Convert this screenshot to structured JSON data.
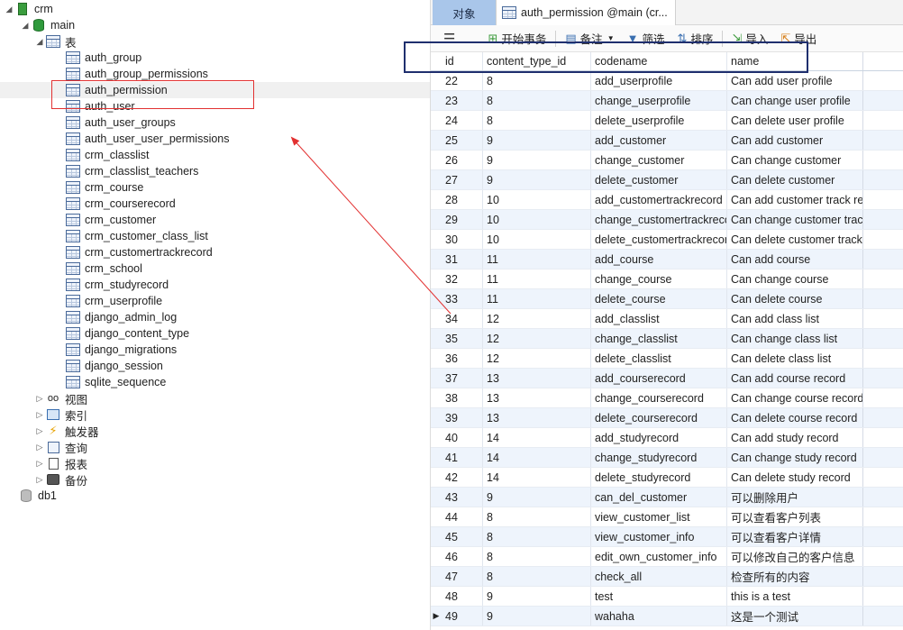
{
  "tree": {
    "connection": "crm",
    "database": "main",
    "tables_folder": "表",
    "tables": [
      "auth_group",
      "auth_group_permissions",
      "auth_permission",
      "auth_user",
      "auth_user_groups",
      "auth_user_user_permissions",
      "crm_classlist",
      "crm_classlist_teachers",
      "crm_course",
      "crm_courserecord",
      "crm_customer",
      "crm_customer_class_list",
      "crm_customertrackrecord",
      "crm_school",
      "crm_studyrecord",
      "crm_userprofile",
      "django_admin_log",
      "django_content_type",
      "django_migrations",
      "django_session",
      "sqlite_sequence"
    ],
    "selected_table": "auth_permission",
    "folders": [
      {
        "label": "视图",
        "icon": "glasses-icon"
      },
      {
        "label": "索引",
        "icon": "index-icon"
      },
      {
        "label": "触发器",
        "icon": "lightning-icon"
      },
      {
        "label": "查询",
        "icon": "query-icon"
      },
      {
        "label": "报表",
        "icon": "report-icon"
      },
      {
        "label": "备份",
        "icon": "backup-icon"
      }
    ],
    "other_db": "db1"
  },
  "tabs": {
    "objects": "对象",
    "active": "auth_permission @main (cr..."
  },
  "toolbar": {
    "begin_transaction": "开始事务",
    "note": "备注",
    "filter": "筛选",
    "sort": "排序",
    "import": "导入",
    "export": "导出"
  },
  "grid": {
    "columns": [
      "id",
      "content_type_id",
      "codename",
      "name"
    ],
    "current_row_id": "49",
    "rows": [
      [
        "22",
        "8",
        "add_userprofile",
        "Can add user profile"
      ],
      [
        "23",
        "8",
        "change_userprofile",
        "Can change user profile"
      ],
      [
        "24",
        "8",
        "delete_userprofile",
        "Can delete user profile"
      ],
      [
        "25",
        "9",
        "add_customer",
        "Can add customer"
      ],
      [
        "26",
        "9",
        "change_customer",
        "Can change customer"
      ],
      [
        "27",
        "9",
        "delete_customer",
        "Can delete customer"
      ],
      [
        "28",
        "10",
        "add_customertrackrecord",
        "Can add customer track record"
      ],
      [
        "29",
        "10",
        "change_customertrackrecord",
        "Can change customer track record"
      ],
      [
        "30",
        "10",
        "delete_customertrackrecord",
        "Can delete customer track record"
      ],
      [
        "31",
        "11",
        "add_course",
        "Can add course"
      ],
      [
        "32",
        "11",
        "change_course",
        "Can change course"
      ],
      [
        "33",
        "11",
        "delete_course",
        "Can delete course"
      ],
      [
        "34",
        "12",
        "add_classlist",
        "Can add class list"
      ],
      [
        "35",
        "12",
        "change_classlist",
        "Can change class list"
      ],
      [
        "36",
        "12",
        "delete_classlist",
        "Can delete class list"
      ],
      [
        "37",
        "13",
        "add_courserecord",
        "Can add course record"
      ],
      [
        "38",
        "13",
        "change_courserecord",
        "Can change course record"
      ],
      [
        "39",
        "13",
        "delete_courserecord",
        "Can delete course record"
      ],
      [
        "40",
        "14",
        "add_studyrecord",
        "Can add study record"
      ],
      [
        "41",
        "14",
        "change_studyrecord",
        "Can change study record"
      ],
      [
        "42",
        "14",
        "delete_studyrecord",
        "Can delete study record"
      ],
      [
        "43",
        "9",
        "can_del_customer",
        "可以删除用户"
      ],
      [
        "44",
        "8",
        "view_customer_list",
        "可以查看客户列表"
      ],
      [
        "45",
        "8",
        "view_customer_info",
        "可以查看客户详情"
      ],
      [
        "46",
        "8",
        "edit_own_customer_info",
        "可以修改自己的客户信息"
      ],
      [
        "47",
        "8",
        "check_all",
        "检查所有的内容"
      ],
      [
        "48",
        "9",
        "test",
        "this is a test"
      ],
      [
        "49",
        "9",
        "wahaha",
        "这是一个测试"
      ]
    ]
  },
  "colors": {
    "highlight_red": "#e23131",
    "highlight_navy": "#1f2f6e",
    "tab_active_bg": "#a9c6ea",
    "row_alt_bg": "#eef4fc"
  }
}
